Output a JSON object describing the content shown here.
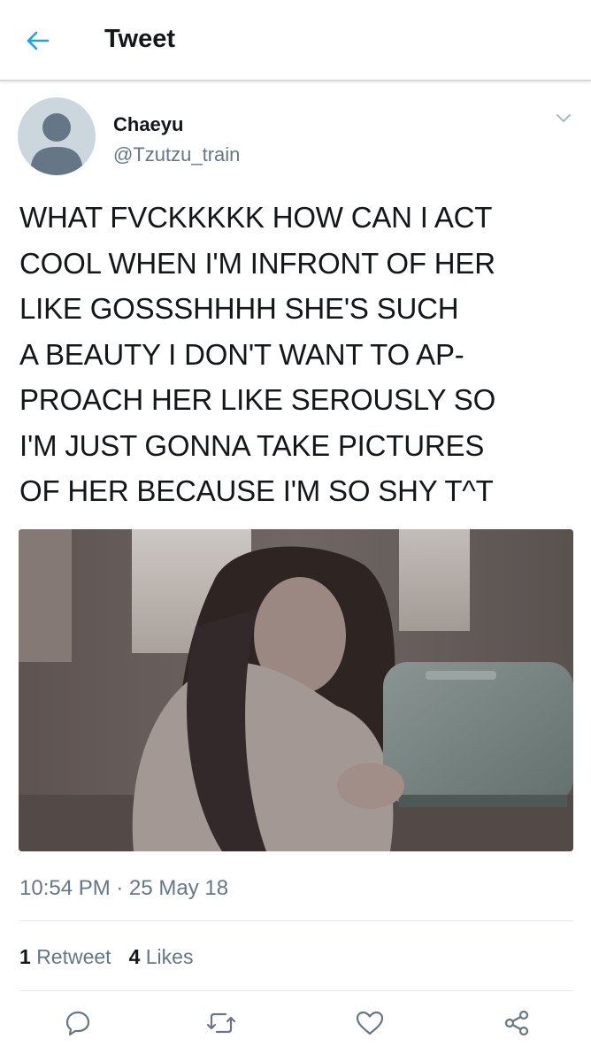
{
  "header": {
    "title": "Tweet",
    "back_icon": "arrow-left-icon",
    "accent_color": "#1da1f2"
  },
  "tweet": {
    "display_name": "Chaeyu",
    "handle": "@Tzutzu_train",
    "text_lines": [
      "WHAT FVCKKKKK HOW CAN I ACT",
      "COOL WHEN I'M INFRONT OF HER",
      "LIKE GOSSSHHHH SHE'S SUCH",
      "A BEAUTY I DON'T WANT TO AP-",
      "PROACH HER LIKE SEROUSLY SO",
      "I'M JUST GONNA TAKE PICTURES",
      "OF HER BECAUSE I'M SO SHY T^T"
    ],
    "timestamp": "10:54 PM · 25 May 18",
    "retweet_count": "1",
    "retweet_label": "Retweet",
    "like_count": "4",
    "like_label": "Likes"
  },
  "actions": [
    "reply-icon",
    "retweet-icon",
    "like-icon",
    "share-icon"
  ]
}
